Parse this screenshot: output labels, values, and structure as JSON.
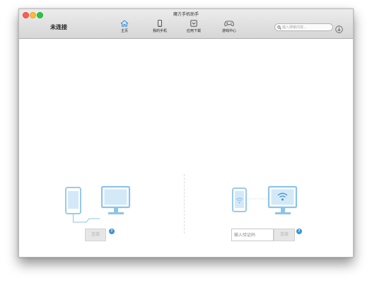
{
  "window": {
    "title": "魔方手机助手",
    "connection_status": "未连接"
  },
  "toolbar": {
    "tabs": [
      {
        "label": "主页",
        "icon": "home-icon",
        "active": true
      },
      {
        "label": "我的手机",
        "icon": "phone-icon",
        "active": false
      },
      {
        "label": "应用下载",
        "icon": "app-download-icon",
        "active": false
      },
      {
        "label": "游戏中心",
        "icon": "gamepad-icon",
        "active": false
      }
    ],
    "search": {
      "placeholder": "输入搜索内容...",
      "value": ""
    },
    "download_icon": "download-icon"
  },
  "usb_panel": {
    "illustration": "phone-usb-cable-to-monitor",
    "connect_label": "连接",
    "help_label": "?"
  },
  "wifi_panel": {
    "illustration": "phone-wifi-to-monitor",
    "code_placeholder": "输入验证码",
    "code_value": "",
    "connect_label": "连接",
    "help_label": "?"
  },
  "colors": {
    "accent": "#3c93d8",
    "illustration": "#8cc4ea",
    "disabled_button": "#e6e6e6"
  }
}
